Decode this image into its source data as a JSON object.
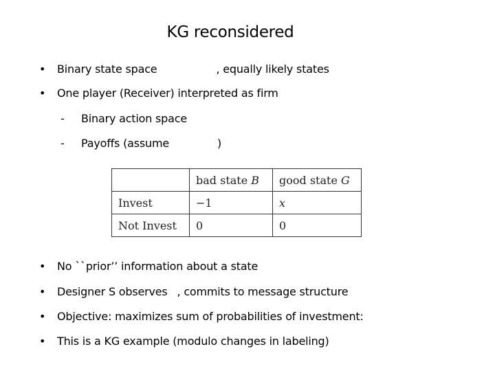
{
  "title": "KG reconsidered",
  "bullets_top": [
    {
      "text_before": "Binary state space",
      "text_after": ", equally likely states"
    },
    {
      "text": "One player (Receiver) interpreted as firm"
    }
  ],
  "sub_bullets": [
    {
      "marker": "-",
      "text": "Binary action space"
    },
    {
      "marker": "-",
      "text_before": "Payoffs  (assume",
      "text_after": ")"
    }
  ],
  "payoff_table": {
    "header": [
      "",
      "bad state ",
      "good state "
    ],
    "header_vars": [
      "",
      "B",
      "G"
    ],
    "rows": [
      {
        "action": "Invest",
        "bad": "−1",
        "good": "x"
      },
      {
        "action": "Not Invest",
        "bad": "0",
        "good": "0"
      }
    ]
  },
  "bullets_bottom": [
    {
      "text": "No ``prior’’ information about a state"
    },
    {
      "text_before": "Designer S observes",
      "text_after": ", commits to message structure"
    },
    {
      "text": "Objective: maximizes sum of probabilities of investment:"
    },
    {
      "text": "This is a KG example (modulo changes in labeling)"
    }
  ],
  "bullet_marker": "•"
}
